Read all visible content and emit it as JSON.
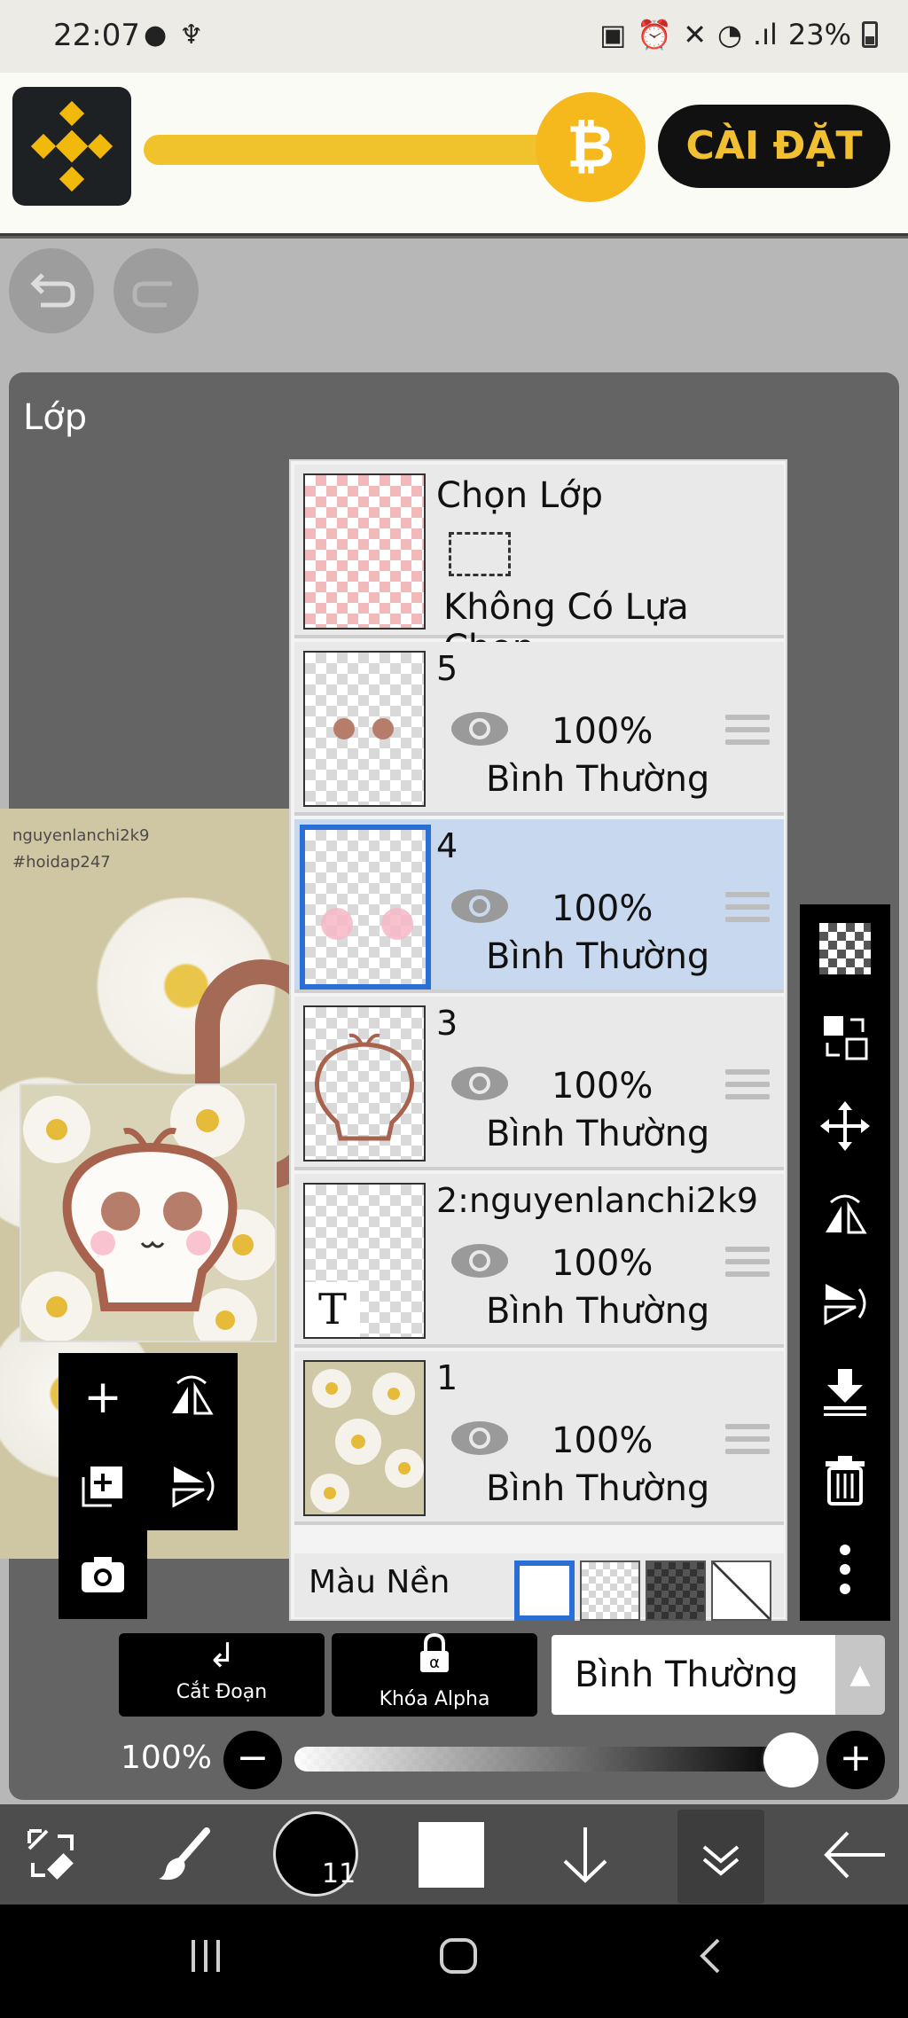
{
  "status_bar": {
    "time": "22:07",
    "battery_percent": "23%"
  },
  "ad": {
    "install_label": "CÀI ĐẶT",
    "coin_symbol": "₿"
  },
  "panel": {
    "title": "Lớp"
  },
  "watermark": {
    "line1": "nguyenlanchi2k9",
    "line2": "#hoidap247"
  },
  "selection_layer": {
    "title": "Chọn Lớp",
    "subtitle": "Không Có Lựa Chọn"
  },
  "layers": [
    {
      "name": "5",
      "opacity": "100%",
      "blend": "Bình Thường",
      "selected": false
    },
    {
      "name": "4",
      "opacity": "100%",
      "blend": "Bình Thường",
      "selected": true
    },
    {
      "name": "3",
      "opacity": "100%",
      "blend": "Bình Thường",
      "selected": false
    },
    {
      "name": "2:nguyenlanchi2k9",
      "opacity": "100%",
      "blend": "Bình Thường",
      "selected": false
    },
    {
      "name": "1",
      "opacity": "100%",
      "blend": "Bình Thường",
      "selected": false
    }
  ],
  "background_row": {
    "label": "Màu Nền"
  },
  "bottom_controls": {
    "clip_label": "Cắt Đoạn",
    "alpha_lock_label": "Khóa Alpha",
    "blend_mode": "Bình Thường",
    "opacity_label": "100%",
    "opacity_value": 1.0
  },
  "bottom_toolbar": {
    "brush_size": "11"
  },
  "colors": {
    "accent_blue": "#2a6fd6",
    "selected_row": "#c8d8ee",
    "binance_yellow": "#f0c22c"
  }
}
